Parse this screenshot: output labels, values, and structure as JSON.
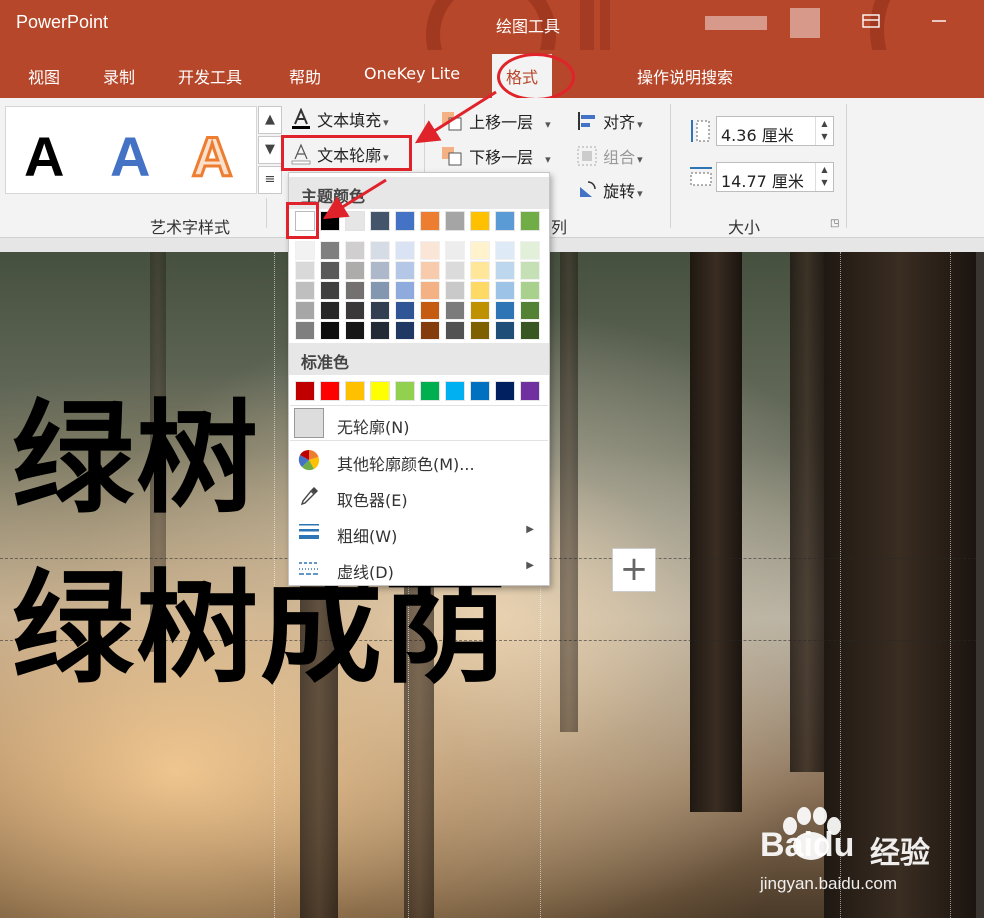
{
  "app_title": "PowerPoint",
  "context_tab_title": "绘图工具",
  "tabs": [
    {
      "label": "视图",
      "active": false
    },
    {
      "label": "录制",
      "active": false
    },
    {
      "label": "开发工具",
      "active": false
    },
    {
      "label": "帮助",
      "active": false
    },
    {
      "label": "OneKey Lite",
      "active": false
    },
    {
      "label": "格式",
      "active": true
    }
  ],
  "tell_me": "操作说明搜索",
  "wordart": {
    "group_label": "艺术字样式",
    "text_fill": "文本填充",
    "text_outline": "文本轮廓",
    "styles": [
      "black",
      "blue",
      "orange-outline"
    ],
    "gallery_glyph": "A"
  },
  "arrange": {
    "group_label_partial": "列",
    "bring_forward": "上移一层",
    "send_backward": "下移一层",
    "align": "对齐",
    "group": "组合",
    "rotate": "旋转"
  },
  "size": {
    "group_label": "大小",
    "height": "4.36 厘米",
    "width": "14.77 厘米"
  },
  "dropdown": {
    "theme_colors_label": "主题颜色",
    "standard_colors_label": "标准色",
    "theme_top_row": [
      "#ffffff",
      "#000000",
      "#e7e6e6",
      "#44546a",
      "#4472c4",
      "#ed7d31",
      "#a5a5a5",
      "#ffc000",
      "#5b9bd5",
      "#70ad47"
    ],
    "theme_shades": [
      [
        "#f2f2f2",
        "#d9d9d9",
        "#bfbfbf",
        "#a6a6a6",
        "#7f7f7f"
      ],
      [
        "#7f7f7f",
        "#595959",
        "#3f3f3f",
        "#262626",
        "#0d0d0d"
      ],
      [
        "#d0cece",
        "#aeabab",
        "#757070",
        "#3a3838",
        "#171616"
      ],
      [
        "#d6dce5",
        "#adb9ca",
        "#8497b0",
        "#333f50",
        "#222a35"
      ],
      [
        "#dae3f3",
        "#b4c7e7",
        "#8faadc",
        "#2f5597",
        "#203864"
      ],
      [
        "#fbe5d6",
        "#f8cbad",
        "#f4b183",
        "#c55a11",
        "#843c0c"
      ],
      [
        "#ededed",
        "#dbdbdb",
        "#c9c9c9",
        "#7b7b7b",
        "#525252"
      ],
      [
        "#fff2cc",
        "#ffe699",
        "#ffd966",
        "#bf9000",
        "#7f6000"
      ],
      [
        "#deebf7",
        "#bdd7ee",
        "#9dc3e6",
        "#2e75b6",
        "#1f4e79"
      ],
      [
        "#e2f0d9",
        "#c5e0b4",
        "#a9d18e",
        "#548235",
        "#385723"
      ]
    ],
    "standard_colors": [
      "#c00000",
      "#ff0000",
      "#ffc000",
      "#ffff00",
      "#92d050",
      "#00b050",
      "#00b0f0",
      "#0070c0",
      "#002060",
      "#7030a0"
    ],
    "items": [
      {
        "label": "无轮廓(N)",
        "icon": "no-outline-icon",
        "submenu": false
      },
      {
        "label": "其他轮廓颜色(M)...",
        "icon": "color-wheel-icon",
        "submenu": false
      },
      {
        "label": "取色器(E)",
        "icon": "eyedropper-icon",
        "submenu": false
      },
      {
        "label": "粗细(W)",
        "icon": "line-weight-icon",
        "submenu": true
      },
      {
        "label": "虚线(D)",
        "icon": "dash-icon",
        "submenu": true
      }
    ]
  },
  "slide": {
    "line1": "绿树",
    "line2": "绿树成荫"
  },
  "watermark": {
    "brand": "Baidu",
    "brand_cn": "经验",
    "url": "jingyan.baidu.com"
  },
  "colors": {
    "accent": "#b7472a",
    "highlight": "#e0232a"
  }
}
